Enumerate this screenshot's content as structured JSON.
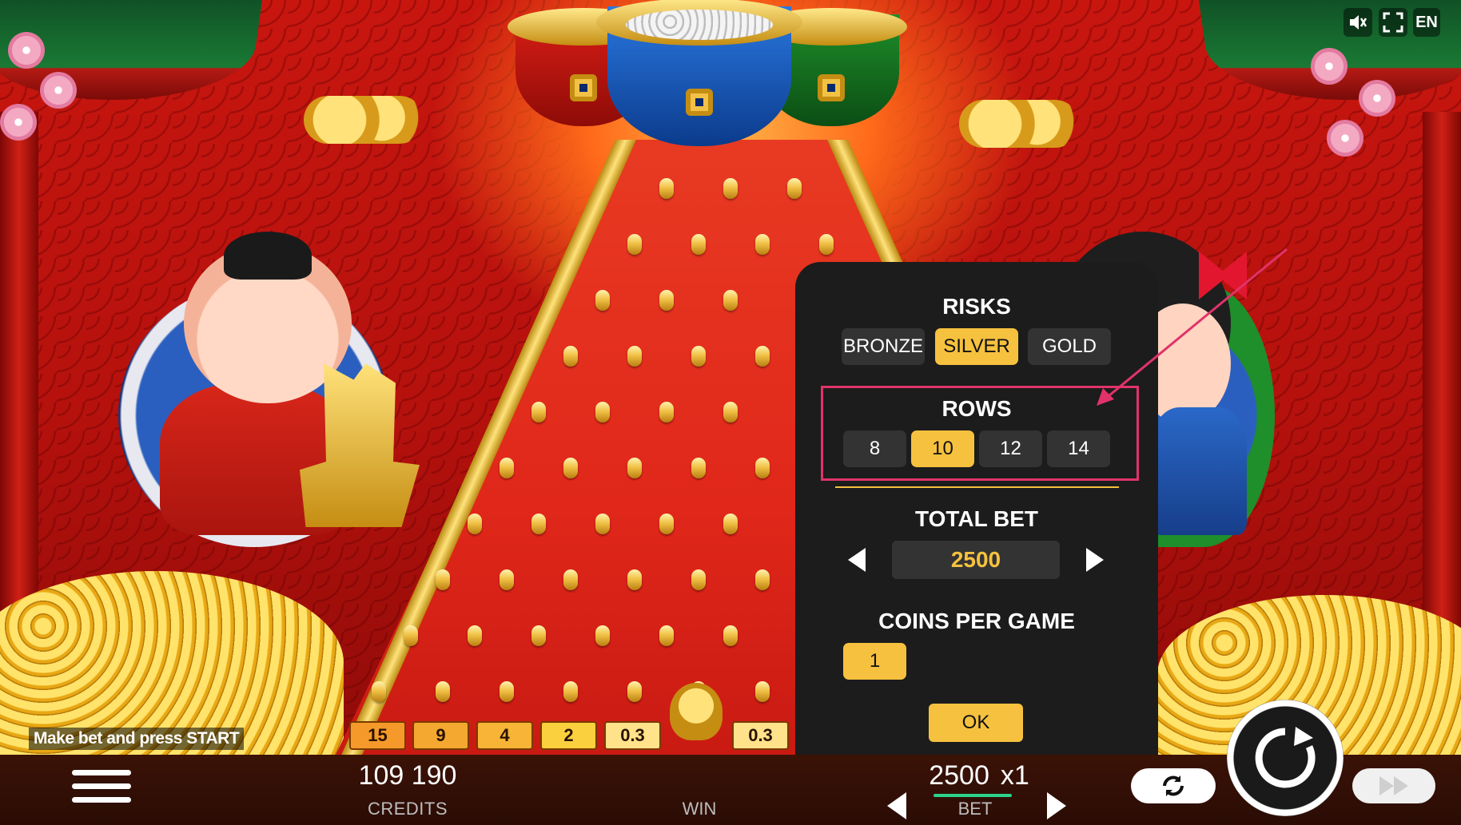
{
  "top_controls": {
    "language": "EN"
  },
  "hint": "Make bet and press START",
  "slots": [
    "15",
    "9",
    "4",
    "2",
    "0.3",
    "0.3"
  ],
  "panel": {
    "risks_title": "RISKS",
    "risks": [
      "BRONZE",
      "SILVER",
      "GOLD"
    ],
    "risks_selected": "SILVER",
    "rows_title": "ROWS",
    "rows": [
      "8",
      "10",
      "12",
      "14"
    ],
    "rows_selected": "10",
    "total_bet_title": "TOTAL BET",
    "total_bet_value": "2500",
    "coins_title": "COINS PER GAME",
    "coins_value": "1",
    "ok_label": "OK"
  },
  "bottom_bar": {
    "credits_value": "109 190",
    "credits_label": "CREDITS",
    "win_label": "WIN",
    "bet_value": "2500",
    "bet_multiplier": "x1",
    "bet_label": "BET"
  },
  "colors": {
    "accent": "#f6c13e",
    "highlight_frame": "#e0336a",
    "panel_bg": "#1c1c1c",
    "option_bg": "#333333"
  }
}
